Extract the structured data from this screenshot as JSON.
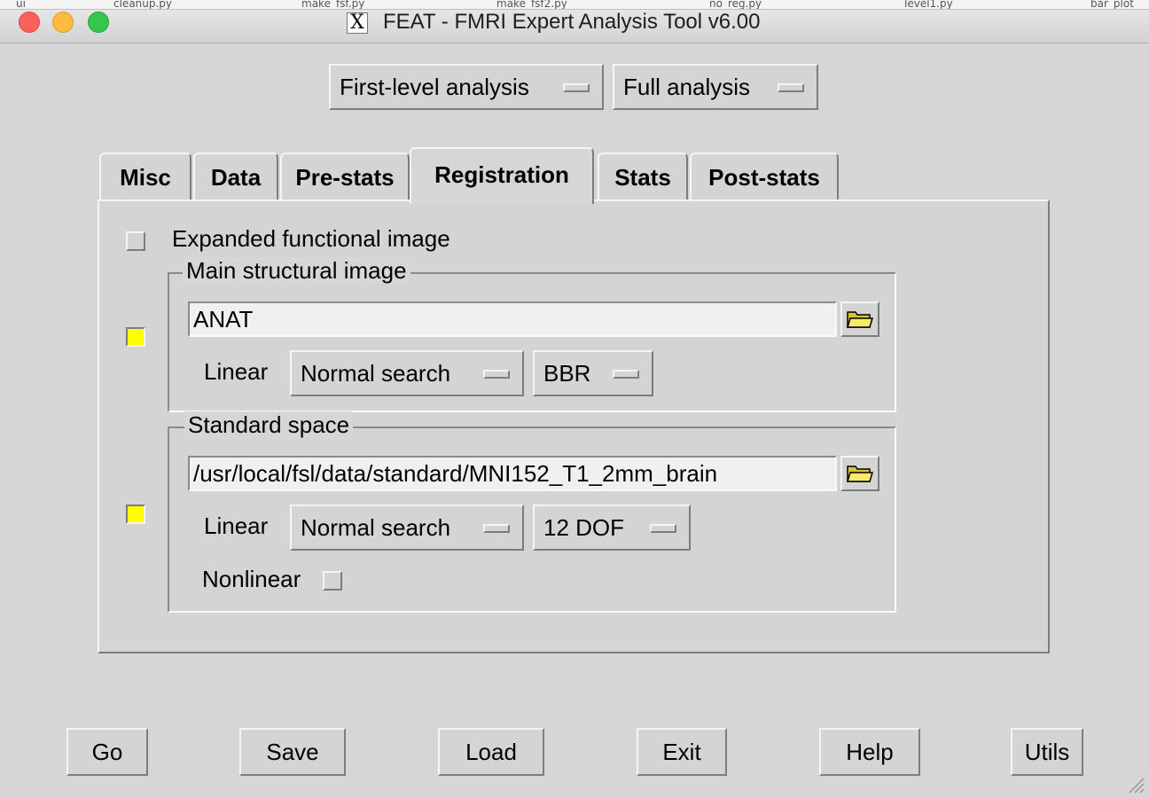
{
  "window": {
    "title": "FEAT - FMRI Expert Analysis Tool v6.00",
    "background_tabs": [
      "ui",
      "cleanup.py",
      "make_fsf.py",
      "make_fsf2.py",
      "no_reg.py",
      "level1.py",
      "bar_plot"
    ]
  },
  "header": {
    "analysis_level": "First-level analysis",
    "analysis_type": "Full analysis"
  },
  "tabs": [
    {
      "label": "Misc",
      "active": false
    },
    {
      "label": "Data",
      "active": false
    },
    {
      "label": "Pre-stats",
      "active": false
    },
    {
      "label": "Registration",
      "active": true
    },
    {
      "label": "Stats",
      "active": false
    },
    {
      "label": "Post-stats",
      "active": false
    }
  ],
  "registration": {
    "expanded_functional": {
      "label": "Expanded functional image",
      "checked": false
    },
    "main_structural": {
      "title": "Main structural image",
      "checked": true,
      "path": "ANAT",
      "linear_label": "Linear",
      "search": "Normal search",
      "dof": "BBR"
    },
    "standard_space": {
      "title": "Standard space",
      "checked": true,
      "path": "/usr/local/fsl/data/standard/MNI152_T1_2mm_brain",
      "linear_label": "Linear",
      "search": "Normal search",
      "dof": "12 DOF",
      "nonlinear_label": "Nonlinear",
      "nonlinear_checked": false
    }
  },
  "buttons": {
    "go": "Go",
    "save": "Save",
    "load": "Load",
    "exit": "Exit",
    "help": "Help",
    "utils": "Utils"
  },
  "icons": {
    "folder": "folder-open-icon",
    "app": "x11-icon"
  },
  "colors": {
    "checked": "#ffff00",
    "background": "#d6d6d6"
  }
}
